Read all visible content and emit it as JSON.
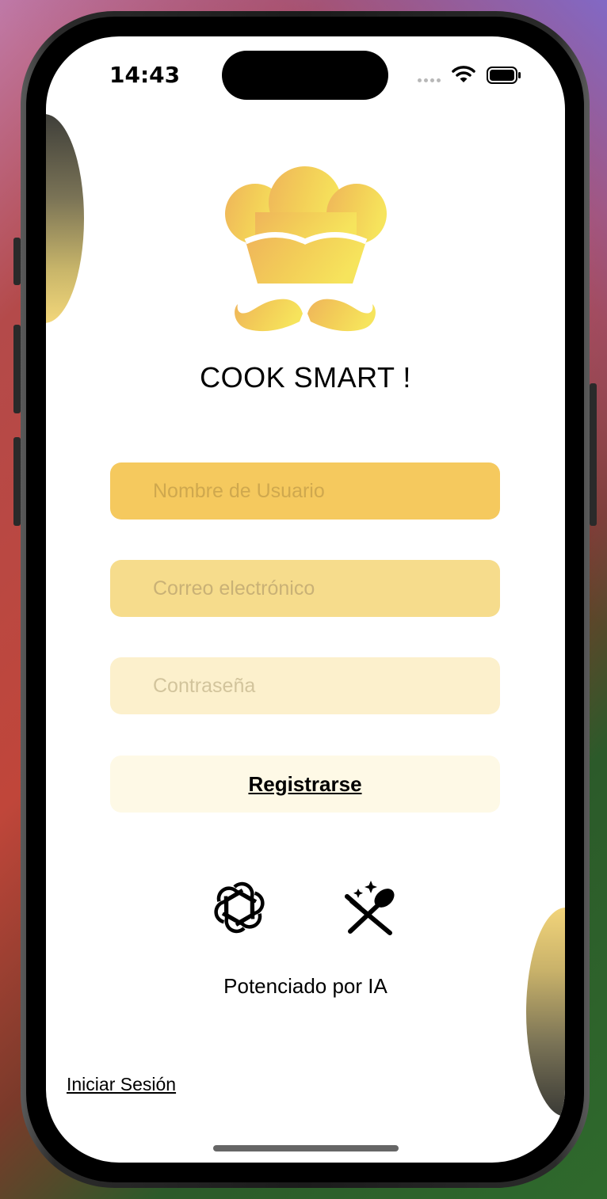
{
  "status_bar": {
    "time": "14:43",
    "icons": [
      "signal-dots-icon",
      "wifi-icon",
      "battery-icon"
    ]
  },
  "app": {
    "title": "COOK SMART !",
    "logo": "chef-hat-mustache-logo",
    "brand_color": "#f5c95e"
  },
  "form": {
    "username": {
      "placeholder": "Nombre de Usuario",
      "value": ""
    },
    "email": {
      "placeholder": "Correo electrónico",
      "value": ""
    },
    "password": {
      "placeholder": "Contraseña",
      "value": ""
    },
    "register_label": "Registrarse"
  },
  "footer": {
    "icons": [
      "openai-icon",
      "magic-cooking-utensils-icon"
    ],
    "powered_label": "Potenciado por IA",
    "login_link": "Iniciar Sesión"
  }
}
